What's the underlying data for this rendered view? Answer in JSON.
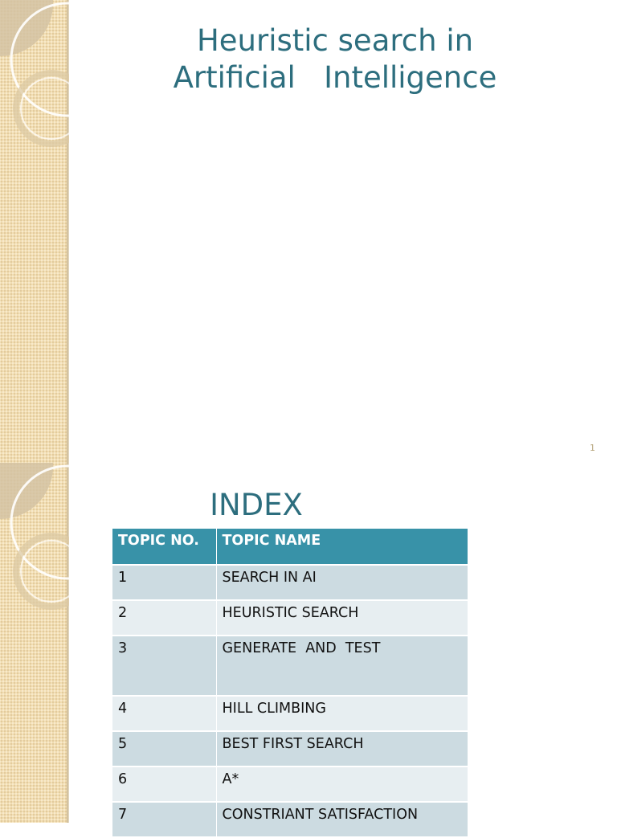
{
  "slide1": {
    "title": "Heuristic search in\nArtificial   Intelligence",
    "page_number": "1"
  },
  "slide2": {
    "heading": "INDEX",
    "table": {
      "headers": [
        "TOPIC NO.",
        "TOPIC NAME"
      ],
      "rows": [
        {
          "no": "1",
          "name": "SEARCH IN AI"
        },
        {
          "no": "2",
          "name": "HEURISTIC SEARCH"
        },
        {
          "no": "3",
          "name": "GENERATE  AND  TEST"
        },
        {
          "no": "4",
          "name": "HILL CLIMBING"
        },
        {
          "no": "5",
          "name": "BEST FIRST SEARCH"
        },
        {
          "no": "6",
          "name": "A*"
        },
        {
          "no": "7",
          "name": "CONSTRIANT SATISFACTION"
        }
      ]
    }
  },
  "colors": {
    "title": "#2d6e7e",
    "header_bg": "#3892a8",
    "row_odd": "#ccdbe1",
    "row_even": "#e7eef1",
    "strip": "#f3deb2"
  }
}
